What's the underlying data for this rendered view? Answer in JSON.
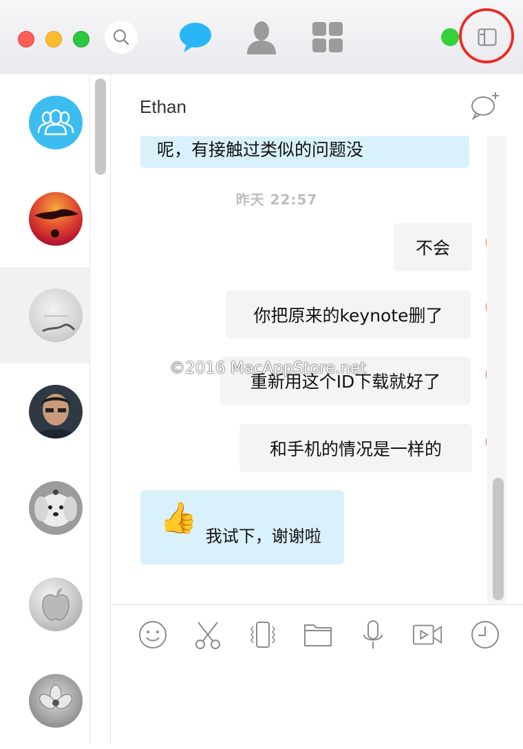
{
  "window": {
    "controls": [
      "close",
      "minimize",
      "zoom"
    ],
    "nav_icons": [
      "chat-bubble-icon",
      "contacts-icon",
      "apps-grid-icon"
    ],
    "online_status_color": "#35d13b",
    "accent_color": "#29b6f6",
    "highlight_color": "#ec2b22"
  },
  "sidebar": {
    "contacts": [
      {
        "name": "group-avatar",
        "avatar": "group"
      },
      {
        "name": "sunset-avatar",
        "avatar": "sunset"
      },
      {
        "name": "gray-avatar",
        "avatar": "gray",
        "selected": true
      },
      {
        "name": "man-avatar",
        "avatar": "man"
      },
      {
        "name": "dog-avatar",
        "avatar": "dog"
      },
      {
        "name": "apple-avatar",
        "avatar": "apple"
      },
      {
        "name": "flower-avatar",
        "avatar": "flower"
      }
    ]
  },
  "chat": {
    "title": "Ethan",
    "messages": [
      {
        "side": "in",
        "text": "呢，有接触过类似的问题没"
      },
      {
        "type": "time",
        "text": "昨天  22:57"
      },
      {
        "side": "out",
        "text": "不会"
      },
      {
        "side": "out",
        "text": "你把原来的keynote删了"
      },
      {
        "side": "out",
        "text": "重新用这个ID下载就好了"
      },
      {
        "side": "out",
        "text": "和手机的情况是一样的"
      },
      {
        "side": "in",
        "text": "我试下，谢谢啦",
        "emoji": "👍"
      }
    ],
    "watermark": "©2016 MacAppStore.net"
  },
  "toolbar": {
    "tools": [
      "emoji-icon",
      "screenshot-scissors-icon",
      "shake-window-icon",
      "file-folder-icon",
      "voice-microphone-icon",
      "video-call-icon",
      "history-clock-icon"
    ]
  }
}
